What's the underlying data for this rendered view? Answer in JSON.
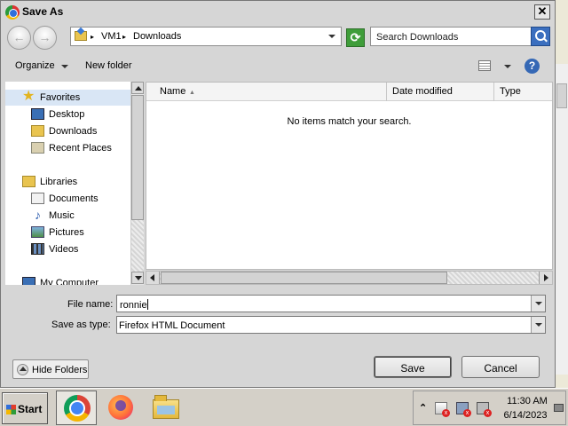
{
  "window": {
    "title": "Save As",
    "close_glyph": "✕"
  },
  "navigation": {
    "back_glyph": "←",
    "forward_glyph": "→",
    "breadcrumb": [
      "VM1",
      "Downloads"
    ],
    "separator": "▸",
    "search_placeholder": "Search Downloads",
    "refresh_glyph": "⟳"
  },
  "commands": {
    "organize": "Organize",
    "new_folder": "New folder",
    "help_glyph": "?"
  },
  "sidebar": {
    "items": [
      {
        "label": "Favorites",
        "icon": "star-icon"
      },
      {
        "label": "Desktop",
        "icon": "desktop-icon"
      },
      {
        "label": "Downloads",
        "icon": "downloads-folder-icon"
      },
      {
        "label": "Recent Places",
        "icon": "recent-places-icon"
      },
      {
        "label": "Libraries",
        "icon": "libraries-icon"
      },
      {
        "label": "Documents",
        "icon": "documents-icon"
      },
      {
        "label": "Music",
        "icon": "music-icon"
      },
      {
        "label": "Pictures",
        "icon": "pictures-icon"
      },
      {
        "label": "Videos",
        "icon": "videos-icon"
      },
      {
        "label": "My Computer",
        "icon": "computer-icon"
      }
    ]
  },
  "file_list": {
    "columns": [
      "Name",
      "Date modified",
      "Type"
    ],
    "empty_message": "No items match your search."
  },
  "form": {
    "file_name_label": "File name:",
    "file_name_value": "ronnie",
    "save_type_label": "Save as type:",
    "save_type_value": "Firefox HTML Document"
  },
  "buttons": {
    "hide_folders": "Hide Folders",
    "save": "Save",
    "cancel": "Cancel"
  },
  "taskbar": {
    "start": "Start",
    "apps": [
      {
        "name": "chrome-icon",
        "active": true
      },
      {
        "name": "firefox-icon",
        "active": false
      },
      {
        "name": "file-explorer-icon",
        "active": false
      }
    ],
    "tray": {
      "chevron": "⌃",
      "time": "11:30 AM",
      "date": "6/14/2023"
    }
  },
  "colors": {
    "selection": "#d9e6f5",
    "refresh": "#3f9d3a",
    "search_button": "#3b6fbf",
    "help": "#3568b5"
  }
}
